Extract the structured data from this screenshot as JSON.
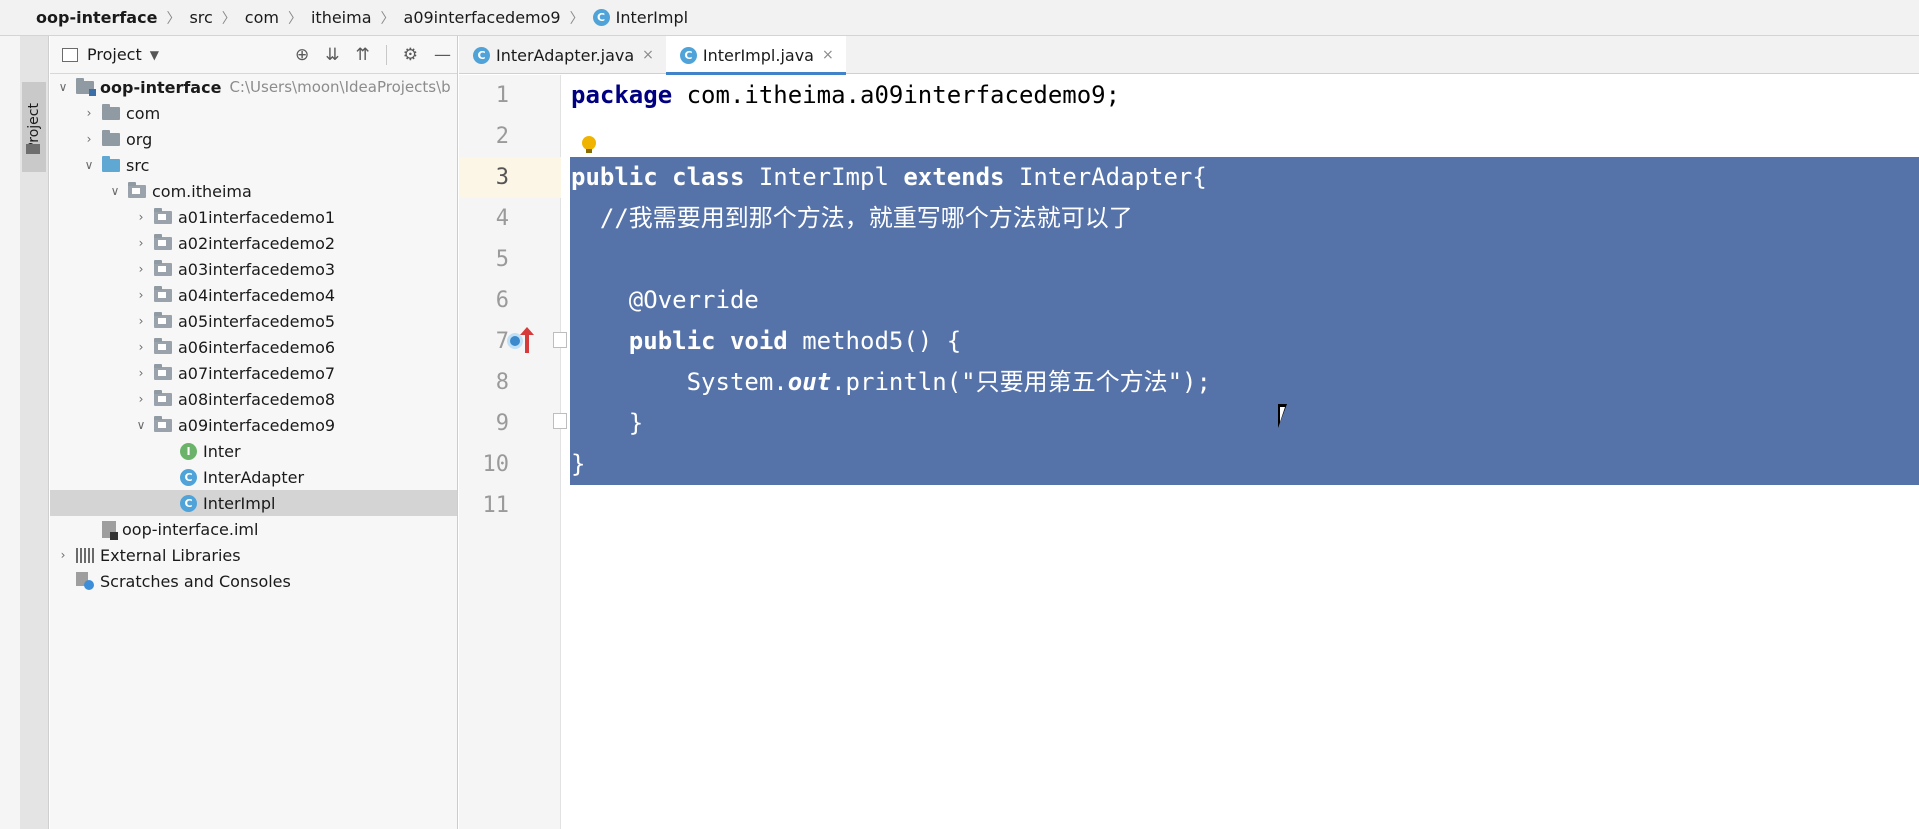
{
  "breadcrumb": {
    "items": [
      "oop-interface",
      "src",
      "com",
      "itheima",
      "a09interfacedemo9",
      "InterImpl"
    ],
    "separator": "〉"
  },
  "left_stripe": {
    "label": "Project"
  },
  "project_panel": {
    "title": "Project",
    "tools": {
      "locate": "⊕",
      "expand": "⇊",
      "collapse": "⇈",
      "settings": "⚙",
      "hide": "—"
    },
    "tree": [
      {
        "label": "oop-interface",
        "hint": "C:\\Users\\moon\\IdeaProjects\\b"
      },
      {
        "label": "com"
      },
      {
        "label": "org"
      },
      {
        "label": "src"
      },
      {
        "label": "com.itheima"
      },
      {
        "label": "a01interfacedemo1"
      },
      {
        "label": "a02interfacedemo2"
      },
      {
        "label": "a03interfacedemo3"
      },
      {
        "label": "a04interfacedemo4"
      },
      {
        "label": "a05interfacedemo5"
      },
      {
        "label": "a06interfacedemo6"
      },
      {
        "label": "a07interfacedemo7"
      },
      {
        "label": "a08interfacedemo8"
      },
      {
        "label": "a09interfacedemo9"
      },
      {
        "label": "Inter"
      },
      {
        "label": "InterAdapter"
      },
      {
        "label": "InterImpl"
      },
      {
        "label": "oop-interface.iml"
      },
      {
        "label": "External Libraries"
      },
      {
        "label": "Scratches and Consoles"
      }
    ]
  },
  "tabs": [
    {
      "label": "InterAdapter.java",
      "close": "×"
    },
    {
      "label": "InterImpl.java",
      "close": "×"
    }
  ],
  "editor": {
    "line_numbers": [
      "1",
      "2",
      "3",
      "4",
      "5",
      "6",
      "7",
      "8",
      "9",
      "10",
      "11"
    ],
    "lines": {
      "l1_kw": "package",
      "l1_rest": " com.itheima.a09interfacedemo9;",
      "l3_kw1": "public",
      "l3_kw2": "class",
      "l3_name": " InterImpl ",
      "l3_kw3": "extends",
      "l3_rest": " InterAdapter{",
      "l4_slash": "  //",
      "l4_comment": "我需要用到那个方法，就重写哪个方法就可以了",
      "l6": "    @Override",
      "l7_kw1": "    public",
      "l7_kw2": "void",
      "l7_rest": " method5() {",
      "l8_a": "        System.",
      "l8_out": "out",
      "l8_b": ".println(\"只要用第五个方法\");",
      "l9": "    }",
      "l10": "}"
    }
  },
  "colors": {
    "selection": "#5673a9",
    "keyword": "#000080",
    "tab_underline": "#4083c9"
  }
}
